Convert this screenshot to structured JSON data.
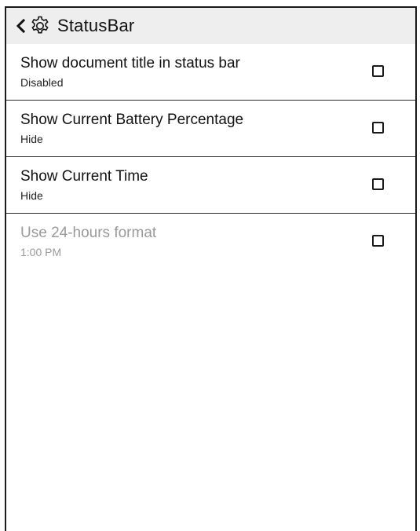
{
  "header": {
    "title": "StatusBar",
    "back_icon": "chevron-left-icon",
    "settings_icon": "gear-icon"
  },
  "settings": [
    {
      "title": "Show document title in status bar",
      "subtitle": "Disabled",
      "checked": false,
      "enabled": true
    },
    {
      "title": "Show Current Battery Percentage",
      "subtitle": "Hide",
      "checked": false,
      "enabled": true
    },
    {
      "title": "Show Current Time",
      "subtitle": "Hide",
      "checked": false,
      "enabled": true
    },
    {
      "title": "Use 24-hours format",
      "subtitle": "1:00 PM",
      "checked": false,
      "enabled": false
    }
  ],
  "colors": {
    "header_bg": "#eeeeee",
    "text": "#111111",
    "disabled_text": "#9a9a9a",
    "divider": "#2a2a2a"
  }
}
